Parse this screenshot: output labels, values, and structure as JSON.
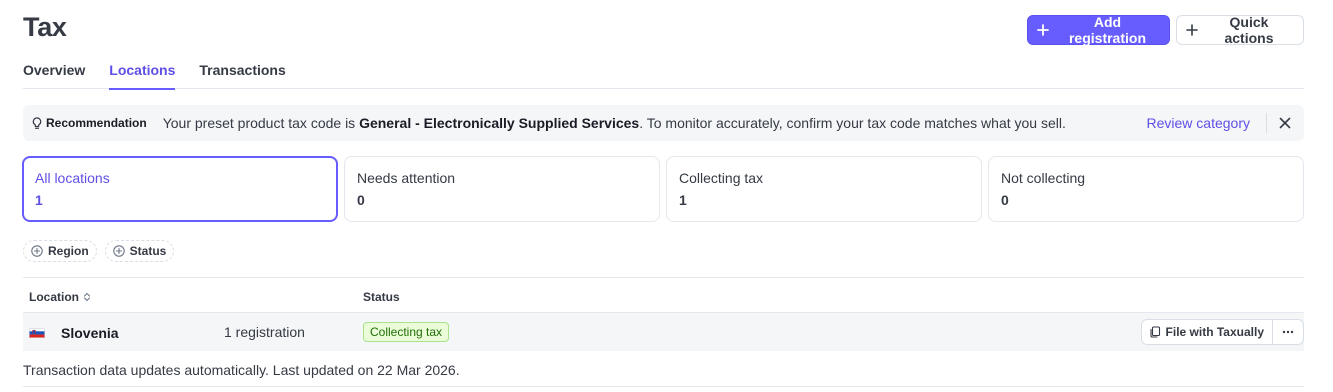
{
  "page": {
    "title": "Tax"
  },
  "header": {
    "add_registration_label": "Add registration",
    "quick_actions_label": "Quick actions"
  },
  "tabs": [
    {
      "label": "Overview",
      "active": false
    },
    {
      "label": "Locations",
      "active": true
    },
    {
      "label": "Transactions",
      "active": false
    }
  ],
  "banner": {
    "tag": "Recommendation",
    "text_before": "Your preset product tax code is ",
    "text_bold": "General - Electronically Supplied Services",
    "text_after": ". To monitor accurately, confirm your tax code matches what you sell.",
    "link_label": "Review category"
  },
  "filters": [
    {
      "label": "All locations",
      "count": "1",
      "active": true
    },
    {
      "label": "Needs attention",
      "count": "0",
      "active": false
    },
    {
      "label": "Collecting tax",
      "count": "1",
      "active": false
    },
    {
      "label": "Not collecting",
      "count": "0",
      "active": false
    }
  ],
  "pills": {
    "region": "Region",
    "status": "Status"
  },
  "table": {
    "columns": {
      "location": "Location",
      "status": "Status"
    },
    "rows": [
      {
        "country": "Slovenia",
        "registrations": "1 registration",
        "status": "Collecting tax",
        "action": "File with Taxually"
      }
    ]
  },
  "footer": {
    "note": "Transaction data updates automatically. Last updated on 22 Mar 2026."
  },
  "colors": {
    "accent": "#675dff",
    "accent_text": "#5e4fe6",
    "success_bg": "#eafdd8",
    "success_text": "#216e07"
  },
  "icons": {
    "plus": "plus-icon",
    "lightbulb": "lightbulb-icon",
    "close": "close-icon",
    "add_circle": "plus-circle-icon",
    "sort": "sort-icon",
    "flag": "slovenia-flag-icon",
    "document": "document-icon",
    "more": "more-icon"
  }
}
